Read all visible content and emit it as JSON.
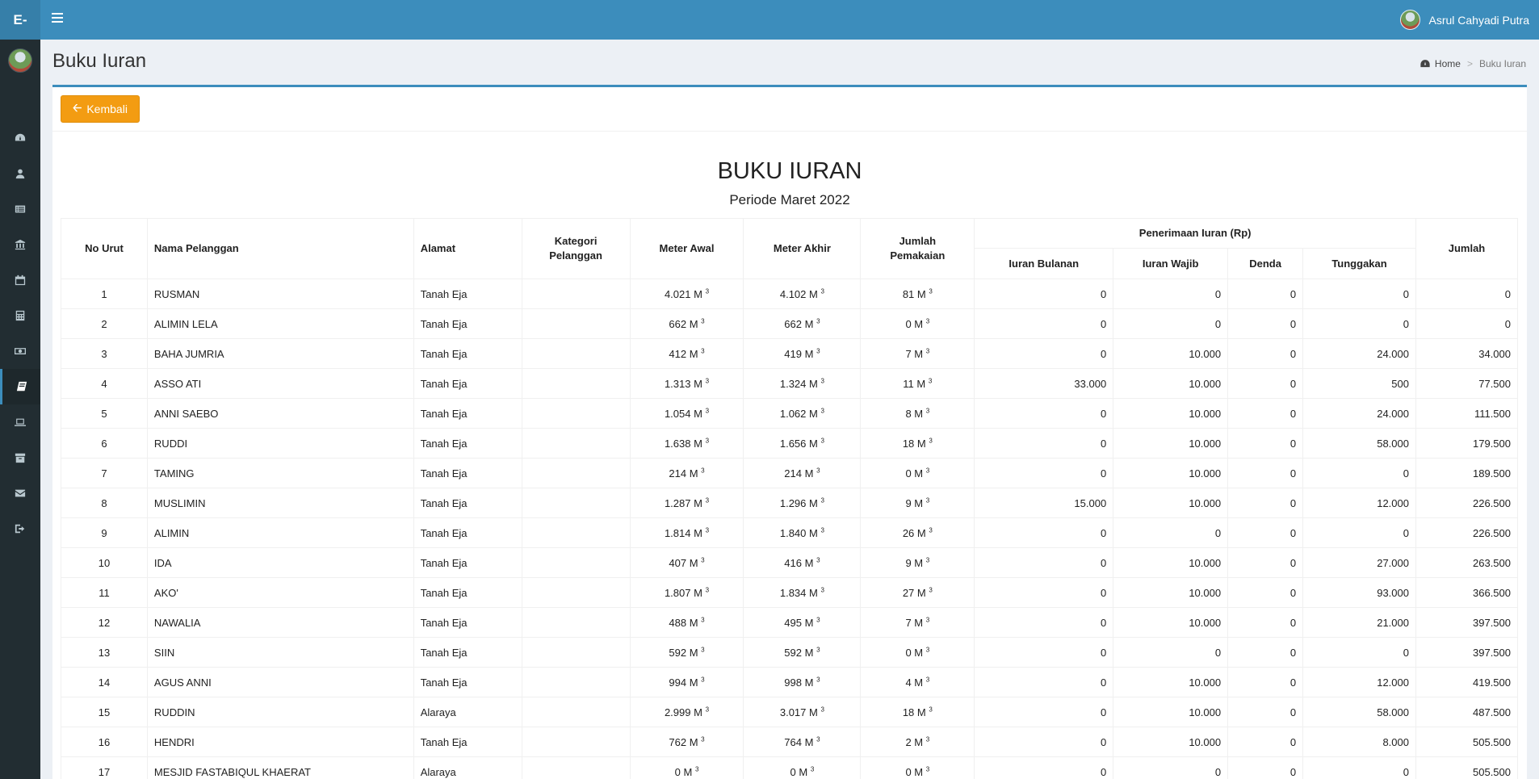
{
  "header": {
    "brand": "E-",
    "user_name": "Asrul Cahyadi Putra"
  },
  "sidebar": {
    "icons": [
      "dashboard-icon",
      "user-icon",
      "list-icon",
      "bank-icon",
      "calendar-icon",
      "calculator-icon",
      "money-icon",
      "book-icon",
      "laptop-icon",
      "archive-icon",
      "envelope-icon",
      "sign-out-icon"
    ],
    "active_index": 7
  },
  "page": {
    "title": "Buku Iuran",
    "breadcrumb_home": "Home",
    "breadcrumb_sep": ">",
    "breadcrumb_current": "Buku Iuran",
    "back_button": "Kembali"
  },
  "report": {
    "title": "BUKU IURAN",
    "period": "Periode Maret 2022"
  },
  "table": {
    "headers": {
      "no_urut": "No Urut",
      "nama": "Nama Pelanggan",
      "alamat": "Alamat",
      "kategori_1": "Kategori",
      "kategori_2": "Pelanggan",
      "meter_awal": "Meter Awal",
      "meter_akhir": "Meter Akhir",
      "jumlah_pemakaian_1": "Jumlah",
      "jumlah_pemakaian_2": "Pemakaian",
      "penerimaan": "Penerimaan Iuran (Rp)",
      "iuran_bulanan": "Iuran Bulanan",
      "iuran_wajib": "Iuran Wajib",
      "denda": "Denda",
      "tunggakan": "Tunggakan",
      "jumlah": "Jumlah"
    },
    "unit": "M",
    "unit_exp": "3",
    "rows": [
      {
        "no": "1",
        "nama": "RUSMAN",
        "alamat": "Tanah Eja",
        "kategori": "",
        "awal": "4.021",
        "akhir": "4.102",
        "pakai": "81",
        "bulanan": "0",
        "wajib": "0",
        "denda": "0",
        "tunggakan": "0",
        "jumlah": "0"
      },
      {
        "no": "2",
        "nama": "ALIMIN LELA",
        "alamat": "Tanah Eja",
        "kategori": "",
        "awal": "662",
        "akhir": "662",
        "pakai": "0",
        "bulanan": "0",
        "wajib": "0",
        "denda": "0",
        "tunggakan": "0",
        "jumlah": "0"
      },
      {
        "no": "3",
        "nama": "BAHA JUMRIA",
        "alamat": "Tanah Eja",
        "kategori": "",
        "awal": "412",
        "akhir": "419",
        "pakai": "7",
        "bulanan": "0",
        "wajib": "10.000",
        "denda": "0",
        "tunggakan": "24.000",
        "jumlah": "34.000"
      },
      {
        "no": "4",
        "nama": "ASSO ATI",
        "alamat": "Tanah Eja",
        "kategori": "",
        "awal": "1.313",
        "akhir": "1.324",
        "pakai": "11",
        "bulanan": "33.000",
        "wajib": "10.000",
        "denda": "0",
        "tunggakan": "500",
        "jumlah": "77.500"
      },
      {
        "no": "5",
        "nama": "ANNI SAEBO",
        "alamat": "Tanah Eja",
        "kategori": "",
        "awal": "1.054",
        "akhir": "1.062",
        "pakai": "8",
        "bulanan": "0",
        "wajib": "10.000",
        "denda": "0",
        "tunggakan": "24.000",
        "jumlah": "111.500"
      },
      {
        "no": "6",
        "nama": "RUDDI",
        "alamat": "Tanah Eja",
        "kategori": "",
        "awal": "1.638",
        "akhir": "1.656",
        "pakai": "18",
        "bulanan": "0",
        "wajib": "10.000",
        "denda": "0",
        "tunggakan": "58.000",
        "jumlah": "179.500"
      },
      {
        "no": "7",
        "nama": "TAMING",
        "alamat": "Tanah Eja",
        "kategori": "",
        "awal": "214",
        "akhir": "214",
        "pakai": "0",
        "bulanan": "0",
        "wajib": "10.000",
        "denda": "0",
        "tunggakan": "0",
        "jumlah": "189.500"
      },
      {
        "no": "8",
        "nama": "MUSLIMIN",
        "alamat": "Tanah Eja",
        "kategori": "",
        "awal": "1.287",
        "akhir": "1.296",
        "pakai": "9",
        "bulanan": "15.000",
        "wajib": "10.000",
        "denda": "0",
        "tunggakan": "12.000",
        "jumlah": "226.500"
      },
      {
        "no": "9",
        "nama": "ALIMIN",
        "alamat": "Tanah Eja",
        "kategori": "",
        "awal": "1.814",
        "akhir": "1.840",
        "pakai": "26",
        "bulanan": "0",
        "wajib": "0",
        "denda": "0",
        "tunggakan": "0",
        "jumlah": "226.500"
      },
      {
        "no": "10",
        "nama": "IDA",
        "alamat": "Tanah Eja",
        "kategori": "",
        "awal": "407",
        "akhir": "416",
        "pakai": "9",
        "bulanan": "0",
        "wajib": "10.000",
        "denda": "0",
        "tunggakan": "27.000",
        "jumlah": "263.500"
      },
      {
        "no": "11",
        "nama": "AKO'",
        "alamat": "Tanah Eja",
        "kategori": "",
        "awal": "1.807",
        "akhir": "1.834",
        "pakai": "27",
        "bulanan": "0",
        "wajib": "10.000",
        "denda": "0",
        "tunggakan": "93.000",
        "jumlah": "366.500"
      },
      {
        "no": "12",
        "nama": "NAWALIA",
        "alamat": "Tanah Eja",
        "kategori": "",
        "awal": "488",
        "akhir": "495",
        "pakai": "7",
        "bulanan": "0",
        "wajib": "10.000",
        "denda": "0",
        "tunggakan": "21.000",
        "jumlah": "397.500"
      },
      {
        "no": "13",
        "nama": "SIIN",
        "alamat": "Tanah Eja",
        "kategori": "",
        "awal": "592",
        "akhir": "592",
        "pakai": "0",
        "bulanan": "0",
        "wajib": "0",
        "denda": "0",
        "tunggakan": "0",
        "jumlah": "397.500"
      },
      {
        "no": "14",
        "nama": "AGUS ANNI",
        "alamat": "Tanah Eja",
        "kategori": "",
        "awal": "994",
        "akhir": "998",
        "pakai": "4",
        "bulanan": "0",
        "wajib": "10.000",
        "denda": "0",
        "tunggakan": "12.000",
        "jumlah": "419.500"
      },
      {
        "no": "15",
        "nama": "RUDDIN",
        "alamat": "Alaraya",
        "kategori": "",
        "awal": "2.999",
        "akhir": "3.017",
        "pakai": "18",
        "bulanan": "0",
        "wajib": "10.000",
        "denda": "0",
        "tunggakan": "58.000",
        "jumlah": "487.500"
      },
      {
        "no": "16",
        "nama": "HENDRI",
        "alamat": "Tanah Eja",
        "kategori": "",
        "awal": "762",
        "akhir": "764",
        "pakai": "2",
        "bulanan": "0",
        "wajib": "10.000",
        "denda": "0",
        "tunggakan": "8.000",
        "jumlah": "505.500"
      },
      {
        "no": "17",
        "nama": "MESJID FASTABIQUL KHAERAT",
        "alamat": "Alaraya",
        "kategori": "",
        "awal": "0",
        "akhir": "0",
        "pakai": "0",
        "bulanan": "0",
        "wajib": "0",
        "denda": "0",
        "tunggakan": "0",
        "jumlah": "505.500"
      }
    ]
  }
}
